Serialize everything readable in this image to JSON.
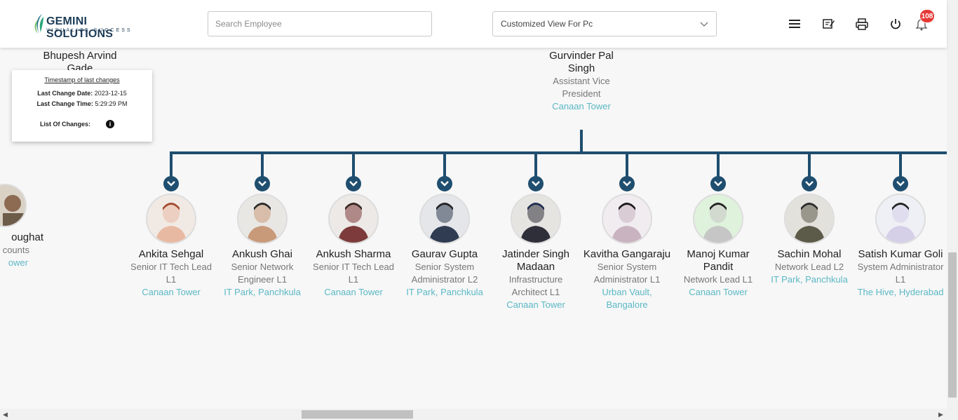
{
  "header": {
    "logo_title": "GEMINI SOLUTIONS",
    "logo_tagline": "VISUALIZE SUCCESS",
    "search_placeholder": "Search Employee",
    "view_select_value": "Customized View For Pc",
    "notification_count": "108",
    "icons": [
      "menu-icon",
      "edit-notes-icon",
      "print-icon",
      "power-icon",
      "bell-icon"
    ]
  },
  "timestamp_card": {
    "title": "Timestamp of last changes",
    "date_label": "Last Change Date:",
    "date_value": "2023-12-15",
    "time_label": "Last Change Time:",
    "time_value": "5:29:29 PM",
    "changes_label": "List Of Changes:"
  },
  "top_left_person": {
    "name": "Bhupesh Arvind Gade"
  },
  "manager": {
    "name": "Gurvinder Pal Singh",
    "designation": "Assistant Vice President",
    "location": "Canaan Tower"
  },
  "partial_person": {
    "name": "oughat",
    "designation": "counts",
    "location": "ower"
  },
  "employees": [
    {
      "name": "Ankita Sehgal",
      "designation": "Senior IT Tech Lead L1",
      "location": "Canaan Tower"
    },
    {
      "name": "Ankush Ghai",
      "designation": "Senior Network Engineer L1",
      "location": "IT Park, Panchkula"
    },
    {
      "name": "Ankush Sharma",
      "designation": "Senior IT Tech Lead L1",
      "location": "Canaan Tower"
    },
    {
      "name": "Gaurav Gupta",
      "designation": "Senior System Administrator L2",
      "location": "IT Park, Panchkula"
    },
    {
      "name": "Jatinder Singh Madaan",
      "designation": "Infrastructure Architect L1",
      "location": "Canaan Tower"
    },
    {
      "name": "Kavitha Gangaraju",
      "designation": "Senior System Administrator L1",
      "location": "Urban Vault, Bangalore"
    },
    {
      "name": "Manoj Kumar Pandit",
      "designation": "Network Lead L1",
      "location": "Canaan Tower"
    },
    {
      "name": "Sachin Mohal",
      "designation": "Network Lead L2",
      "location": "IT Park, Panchkula"
    },
    {
      "name": "Satish Kumar Goli",
      "designation": "System Administrator L1",
      "location": "The Hive, Hyderabad"
    }
  ],
  "colors": {
    "connector": "#1f4e6f",
    "location_text": "#5bb8c5",
    "badge": "#e53935"
  }
}
